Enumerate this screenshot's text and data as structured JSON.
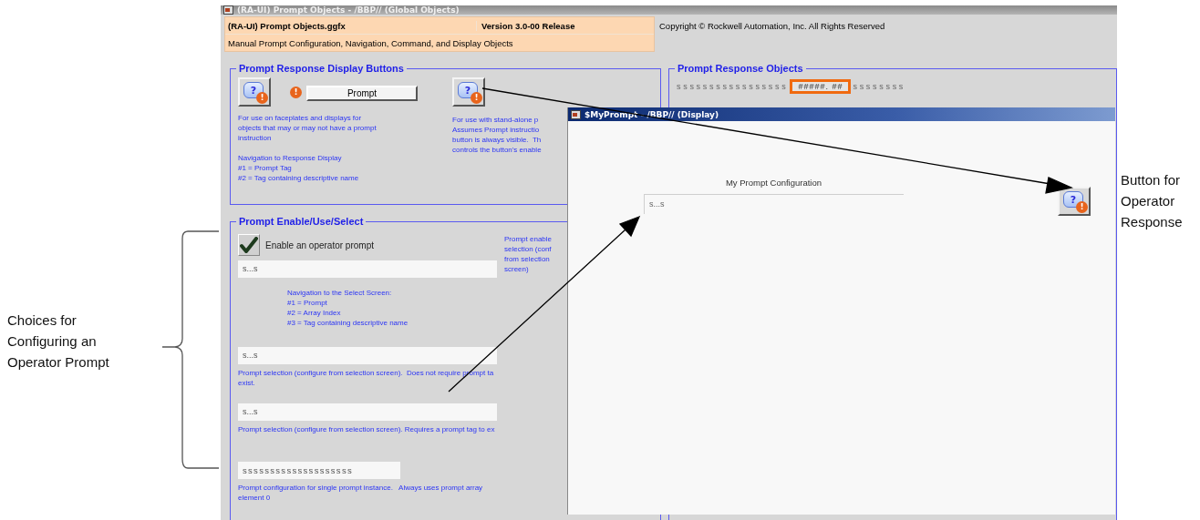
{
  "callouts": [
    {
      "kind": "left_label",
      "lines": [
        "Choices for",
        "Configuring an",
        "Operator Prompt"
      ]
    },
    {
      "kind": "right_label",
      "lines": [
        "Button for",
        "Operator",
        "Response"
      ],
      "icon": {
        "symbol": "?",
        "badge": "!"
      }
    }
  ],
  "main_window": {
    "title": "(RA-UI) Prompt Objects - /BBP// (Global Objects)",
    "header": {
      "file": "(RA-UI) Prompt Objects.ggfx",
      "version": "Version 3.0-00 Release",
      "subtitle": "Manual Prompt Configuration, Navigation, Command, and Display Objects",
      "copyright": "Copyright © Rockwell Automation, Inc.   All Rights Reserved"
    },
    "display_buttons": {
      "title": "Prompt Response Display Buttons",
      "icon_left": {
        "symbol": "?",
        "badge": "!"
      },
      "alert": "!",
      "prompt_button": "Prompt",
      "notes_left": [
        "For use on faceplates and displays for\nobjects that may or may not have a prompt\ninstruction",
        "Navigation to Response Display\n#1 = Prompt Tag\n#2 = Tag containing descriptive name"
      ],
      "icon_right": {
        "symbol": "?",
        "badge": "!"
      },
      "notes_right": [
        "For use with stand-alone p\nAssumes Prompt instructio\nbutton is always visible.  Th\ncontrols the button's enable"
      ]
    },
    "enable_select": {
      "title": "Prompt Enable/Use/Select",
      "items": [
        {
          "kind": "checkbox",
          "label": "Enable an operator prompt",
          "checked": true
        },
        {
          "kind": "field",
          "value": "s...s"
        },
        {
          "kind": "side_note",
          "text": "Prompt enable\nselection (conf\nfrom selection\nscreen)"
        },
        {
          "kind": "indented_note",
          "text": "Navigation to the Select Screen:\n#1 = Prompt\n#2 = Array Index\n#3 = Tag containing descriptive name"
        },
        {
          "kind": "field",
          "value": "s...s"
        },
        {
          "kind": "note",
          "text": "Prompt selection (configure from selection screen).  Does not require prompt ta\nexist."
        },
        {
          "kind": "field",
          "value": "s...s"
        },
        {
          "kind": "note",
          "text": "Prompt selection (configure from selection screen). Requires a prompt tag to ex"
        },
        {
          "kind": "short_field",
          "value": "ssssssssssssssssssss"
        },
        {
          "kind": "note",
          "text": "Prompt configuration for single prompt instance.   Always uses prompt array\nelement 0"
        }
      ]
    },
    "response_objects": {
      "title": "Prompt Response Objects",
      "rows": [
        {
          "prefix": "sssssssssssssssss",
          "value": "#####. ##",
          "suffix": "ssssssss"
        }
      ]
    }
  },
  "overlay_window": {
    "title": "$MyPrompt - /BBP// (Display)",
    "heading": "My Prompt Configuration",
    "field_value": "s...s"
  }
}
